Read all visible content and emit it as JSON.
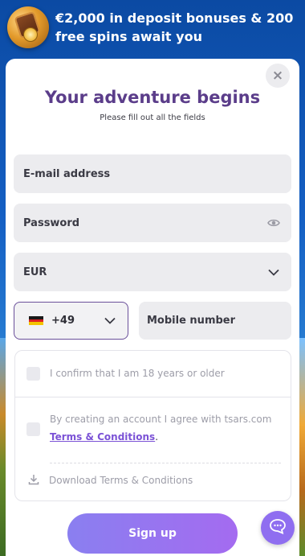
{
  "promo": {
    "text": "€2,000 in deposit bonuses & 200 free spins await you"
  },
  "modal": {
    "close_label": "×",
    "title": "Your adventure begins",
    "subtitle": "Please fill out all the fields"
  },
  "form": {
    "email_placeholder": "E-mail address",
    "password_placeholder": "Password",
    "currency_value": "EUR",
    "phone_code": "+49",
    "phone_flag": "germany-flag-icon",
    "mobile_placeholder": "Mobile number"
  },
  "consent": {
    "age_label": "I confirm that I am 18 years or older",
    "terms_prefix": "By creating an account I agree with tsars.com",
    "terms_link": "Terms & Conditions",
    "terms_suffix": ".",
    "download_label": "Download Terms & Conditions"
  },
  "actions": {
    "signup_label": "Sign up"
  },
  "colors": {
    "accent": "#5b3d8a",
    "link": "#7b52d6",
    "button_start": "#8a7ff0",
    "button_end": "#a46bf0"
  }
}
